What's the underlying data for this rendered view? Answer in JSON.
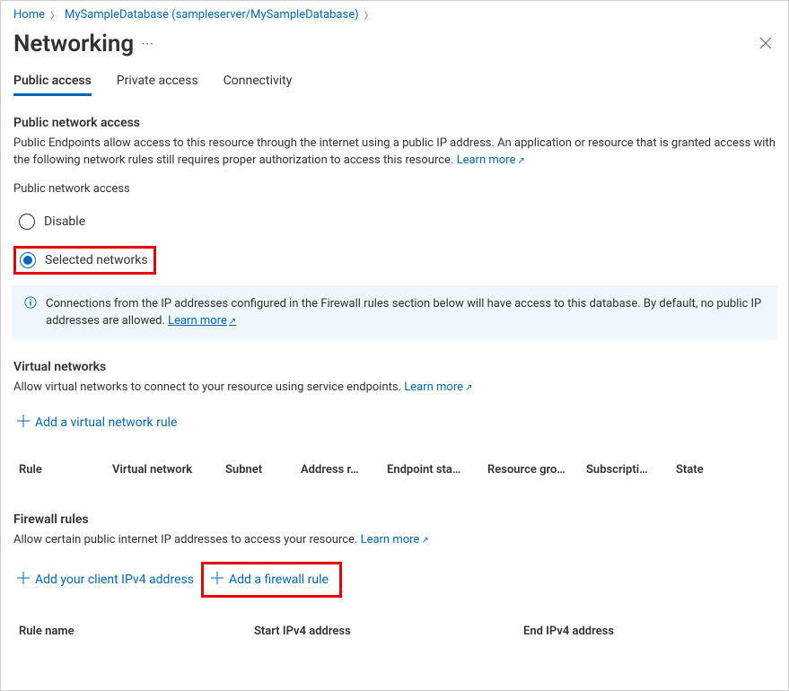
{
  "breadcrumb": {
    "home": "Home",
    "db": "MySampleDatabase (sampleserver/MySampleDatabase)"
  },
  "page": {
    "title": "Networking"
  },
  "tabs": {
    "public": "Public access",
    "private": "Private access",
    "conn": "Connectivity"
  },
  "pna": {
    "heading": "Public network access",
    "desc_a": "Public Endpoints allow access to this resource through the internet using a public IP address. An application or resource that is granted access with the following network rules still requires proper authorization to access this resource. ",
    "learn": "Learn more",
    "label": "Public network access",
    "opt_disable": "Disable",
    "opt_selected": "Selected networks"
  },
  "banner": {
    "text": "Connections from the IP addresses configured in the Firewall rules section below will have access to this database. By default, no public IP addresses are allowed.  ",
    "learn": "Learn more"
  },
  "vnet": {
    "heading": "Virtual networks",
    "desc": "Allow virtual networks to connect to your resource using service endpoints. ",
    "learn": "Learn more",
    "add": "Add a virtual network rule",
    "cols": {
      "rule": "Rule",
      "vnet": "Virtual network",
      "subnet": "Subnet",
      "addr": "Address r…",
      "ep": "Endpoint sta…",
      "rg": "Resource gro…",
      "sub": "Subscripti…",
      "state": "State"
    }
  },
  "fw": {
    "heading": "Firewall rules",
    "desc": "Allow certain public internet IP addresses to access your resource. ",
    "learn": "Learn more",
    "add_client": "Add your client IPv4 address",
    "add_rule": "Add a firewall rule",
    "cols": {
      "name": "Rule name",
      "start": "Start IPv4 address",
      "end": "End IPv4 address"
    }
  }
}
